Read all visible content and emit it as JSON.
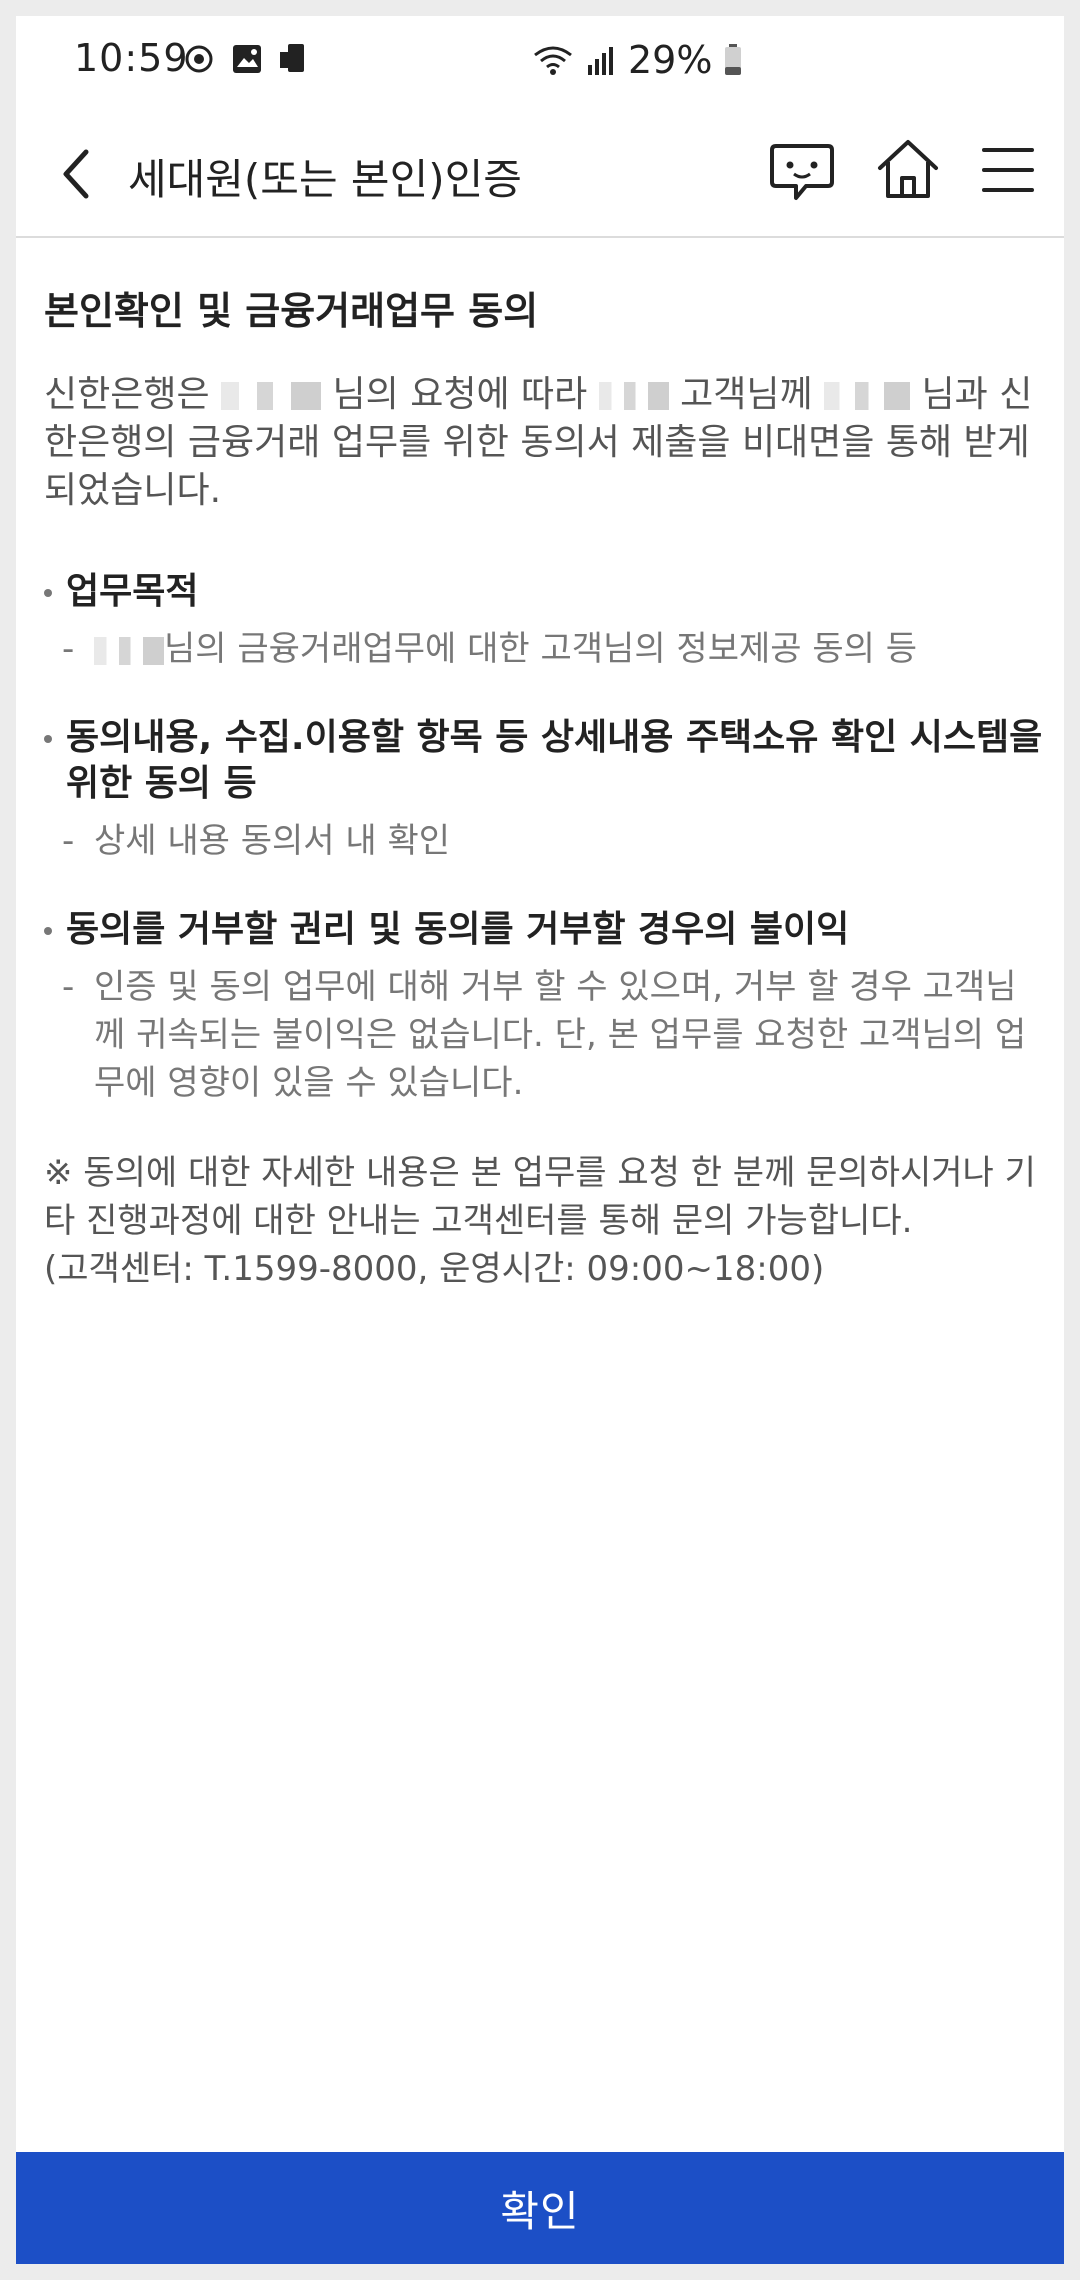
{
  "status_bar": {
    "time": "10:59",
    "battery": "29%",
    "icons": [
      "sync-icon",
      "image-icon",
      "screencast-icon",
      "wifi-icon",
      "signal-icon",
      "battery-icon"
    ]
  },
  "header": {
    "title": "세대원(또는 본인)인증",
    "icons": [
      "back-arrow-icon",
      "chat-icon",
      "home-icon",
      "menu-icon"
    ]
  },
  "content": {
    "section_title": "본인확인 및 금융거래업무 동의",
    "intro": {
      "p1": "신한은행은",
      "p2": "님의 요청에 따라",
      "p3": "고객님께",
      "p4": "님과 신한은행의 금융거래 업무를 위한 동의서 제출을 비대면을 통해 받게 되었습니다."
    },
    "bullets": [
      {
        "title": "업무목적",
        "desc_prefix": "",
        "desc": "님의 금융거래업무에 대한 고객님의 정보제공 동의 등"
      },
      {
        "title": "동의내용, 수집.이용할 항목 등 상세내용 주택소유 확인 시스템을 위한 동의 등",
        "desc": "상세 내용 동의서 내 확인"
      },
      {
        "title": "동의를 거부할 권리 및 동의를 거부할 경우의 불이익",
        "desc": "인증 및 동의 업무에 대해 거부 할 수 있으며, 거부 할 경우 고객님께 귀속되는 불이익은 없습니다. 단, 본 업무를 요청한 고객님의 업무에 영향이 있을 수 있습니다."
      }
    ],
    "notice": "※ 동의에 대한 자세한 내용은 본 업무를 요청 한 분께 문의하시거나 기타 진행과정에 대한 안내는 고객센터를 통해 문의 가능합니다.",
    "contact": "(고객센터: T.1599-8000, 운영시간: 09:00~18:00)"
  },
  "footer": {
    "confirm_label": "확인"
  },
  "colors": {
    "primary": "#1c4fc6",
    "text_dark": "#222222",
    "text_muted": "#777777"
  }
}
